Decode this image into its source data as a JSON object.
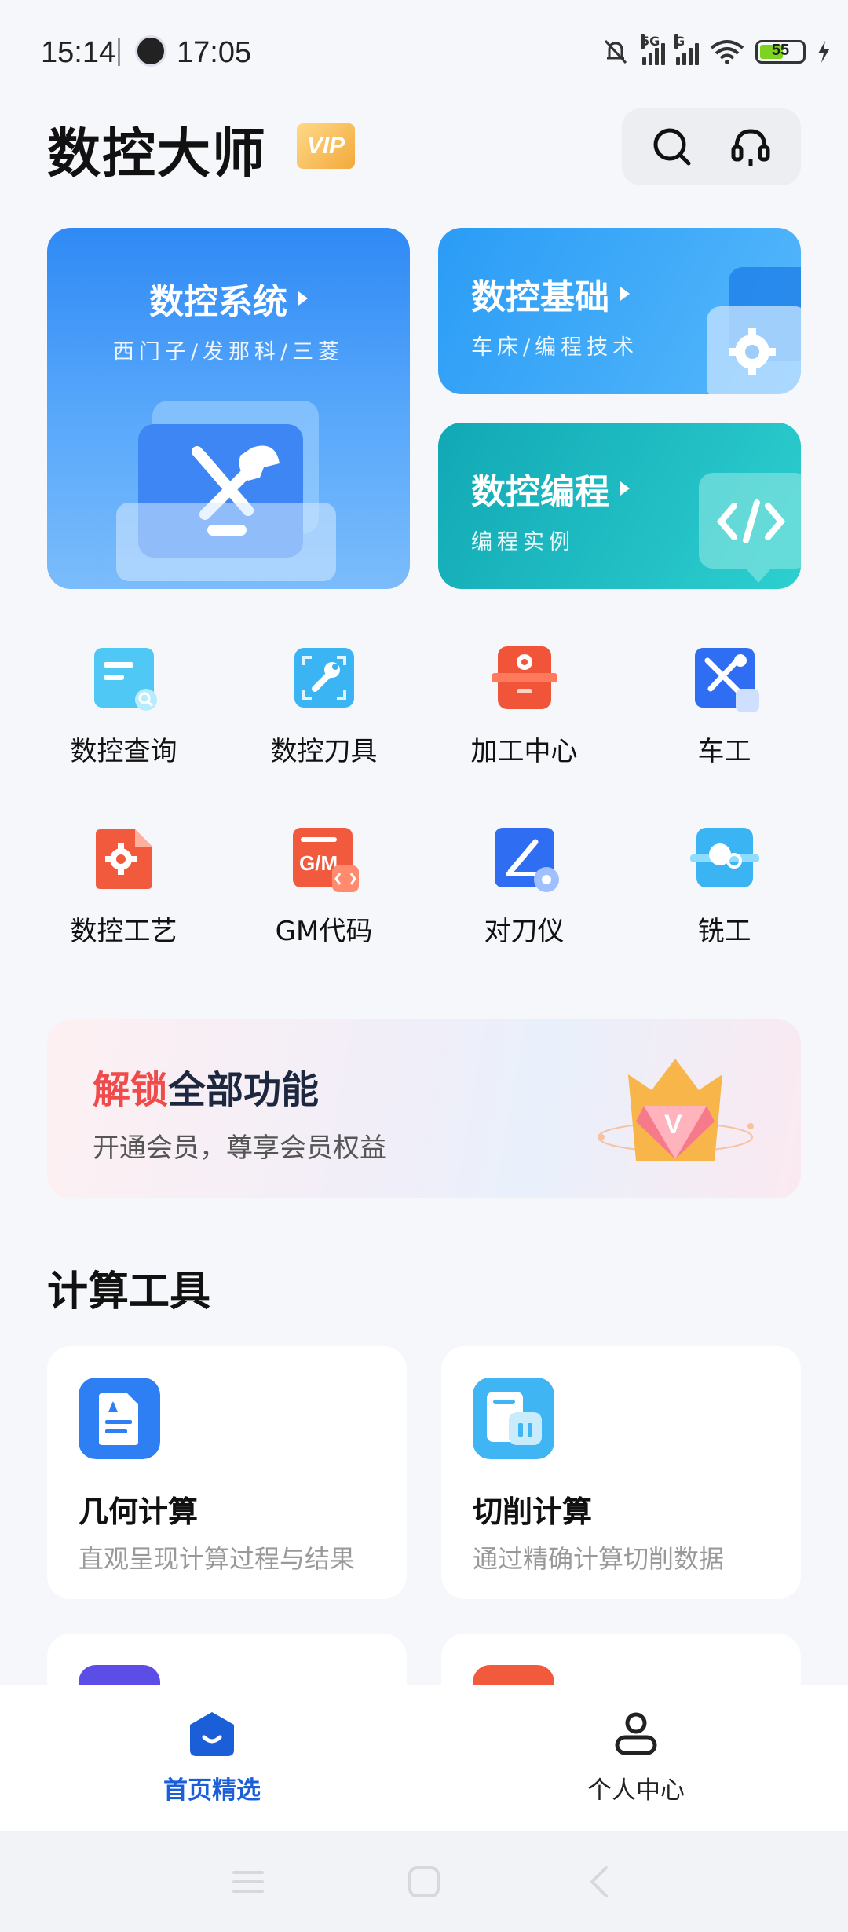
{
  "status_bar": {
    "time": "15:14",
    "clock_app_time": "17:05",
    "signal1_label": "5G",
    "signal2_label": "G",
    "battery": "55"
  },
  "header": {
    "title": "数控大师",
    "vip_badge": "VIP",
    "icons": [
      "search-icon",
      "headset-icon"
    ]
  },
  "feature_cards": [
    {
      "title": "数控系统",
      "subtitle": "西门子/发那科/三菱",
      "icon": "tools-folder-icon",
      "color": "#2f8af5"
    },
    {
      "title": "数控基础",
      "subtitle": "车床/编程技术",
      "icon": "gear-icon",
      "color": "#2a9cf6"
    },
    {
      "title": "数控编程",
      "subtitle": "编程实例",
      "icon": "code-icon",
      "color": "#11a8b5"
    }
  ],
  "grid": [
    {
      "label": "数控查询",
      "icon": "query-icon"
    },
    {
      "label": "数控刀具",
      "icon": "wrench-scan-icon"
    },
    {
      "label": "加工中心",
      "icon": "machining-center-icon"
    },
    {
      "label": "车工",
      "icon": "lathe-tools-icon"
    },
    {
      "label": "数控工艺",
      "icon": "process-gear-icon"
    },
    {
      "label": "GM代码",
      "icon": "gm-code-icon"
    },
    {
      "label": "对刀仪",
      "icon": "tool-setter-icon"
    },
    {
      "label": "铣工",
      "icon": "milling-icon"
    }
  ],
  "promo": {
    "head_red": "解锁",
    "head_dark": "全部功能",
    "subtitle": "开通会员，尊享会员权益"
  },
  "section": {
    "title": "计算工具"
  },
  "tools": [
    {
      "name": "几何计算",
      "desc": "直观呈现计算过程与结果",
      "icon": "document-icon"
    },
    {
      "name": "切削计算",
      "desc": "通过精确计算切削数据",
      "icon": "calc-doc-icon"
    }
  ],
  "bottom_nav": {
    "home": "首页精选",
    "profile": "个人中心"
  },
  "colors": {
    "accent": "#1a5fd8",
    "promo_red": "#f04b4b"
  }
}
